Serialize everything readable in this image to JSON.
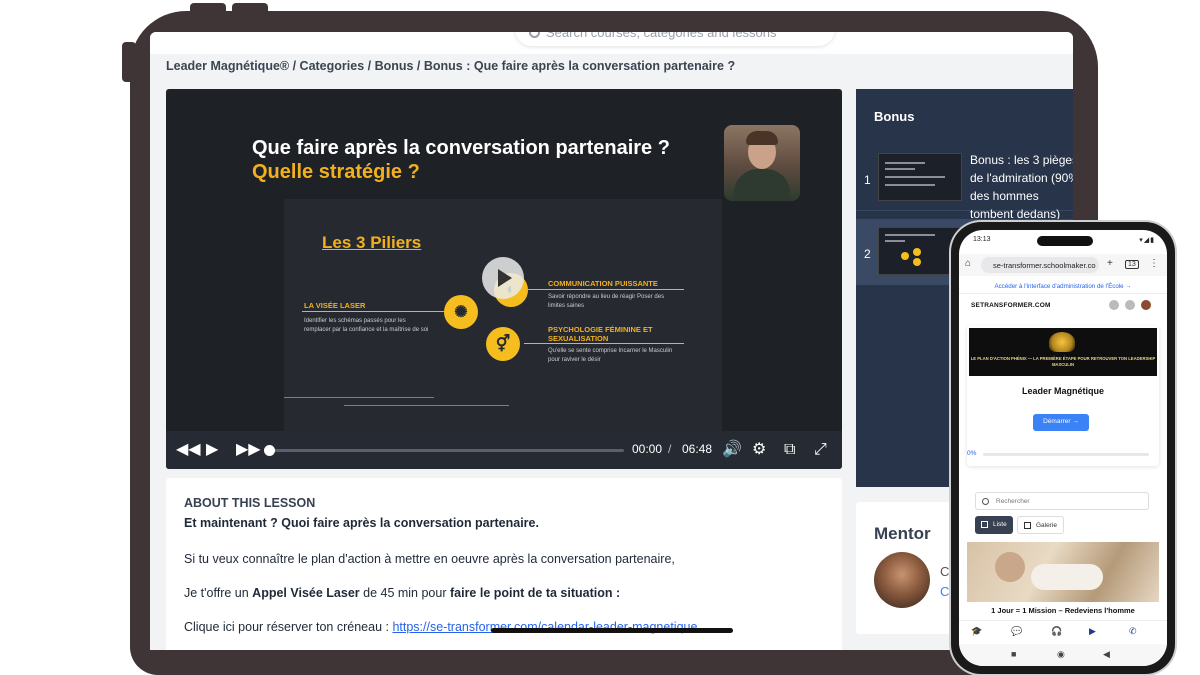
{
  "tablet": {
    "search_placeholder": "Search courses, categories and lessons",
    "breadcrumb": "Leader Magnétique® / Categories / Bonus / Bonus : Que faire après la conversation partenaire ?",
    "video": {
      "title_line1": "Que faire après la conversation partenaire ?",
      "title_line2": "Quelle stratégie ?",
      "slide_heading": "Les 3 Piliers",
      "pillar1_title": "LA VISÉE LASER",
      "pillar1_text": "Identifier les schémas passés pour les remplacer par la confiance et la maîtrise de soi",
      "pillar2_title": "COMMUNICATION PUISSANTE",
      "pillar2_text": "Savoir répondre au lieu de réagir Poser des limites saines",
      "pillar3_title": "PSYCHOLOGIE FÉMININE ET SEXUALISATION",
      "pillar3_text": "Qu'elle se sente comprise Incarner le Masculin pour raviver le désir",
      "current_time": "00:00",
      "time_separator": "/",
      "duration": "06:48",
      "progress": 0.0
    },
    "about": {
      "heading": "ABOUT THIS LESSON",
      "subheading": "Et maintenant ? Quoi faire après la conversation partenaire.",
      "p1": "Si tu veux connaître le plan d'action à mettre en oeuvre après la conversation partenaire,",
      "p2_pre": "Je t'offre un ",
      "p2_bold1": "Appel Visée Laser",
      "p2_mid": " de 45 min pour ",
      "p2_bold2": "faire le point de ta situation :",
      "p3_pre": "Clique ici pour réserver ton créneau : ",
      "p3_link": "https://se-transformer.com/calendar-leader-magnetique"
    },
    "bonus": {
      "title": "Bonus",
      "items": [
        {
          "num": "1",
          "label": "Bonus : les 3 pièges de l'admiration (90% des hommes tombent dedans)"
        },
        {
          "num": "2",
          "label": ""
        }
      ]
    },
    "mentor": {
      "title": "Mentor",
      "name_initial": "C",
      "link_initial": "C"
    }
  },
  "phone": {
    "status_time": "13:13",
    "url": "se-transformer.schoolmaker.co",
    "tab_count": "13",
    "admin_link": "Accéder à l'interface d'administration de l'École →",
    "brand": "SETRANSFORMER.COM",
    "banner_text": "LE PLAN D'ACTION PHÉNIX — LA PREMIÈRE ÉTAPE POUR RETROUVER TON LEADERSHIP MASCULIN",
    "course_title": "Leader Magnétique",
    "start_button": "Démarrer →",
    "progress_label": "0%",
    "search_placeholder": "Rechercher",
    "view_list": "Liste",
    "view_gallery": "Galerie",
    "course2_title": "1 Jour = 1 Mission – Redeviens l'homme"
  }
}
